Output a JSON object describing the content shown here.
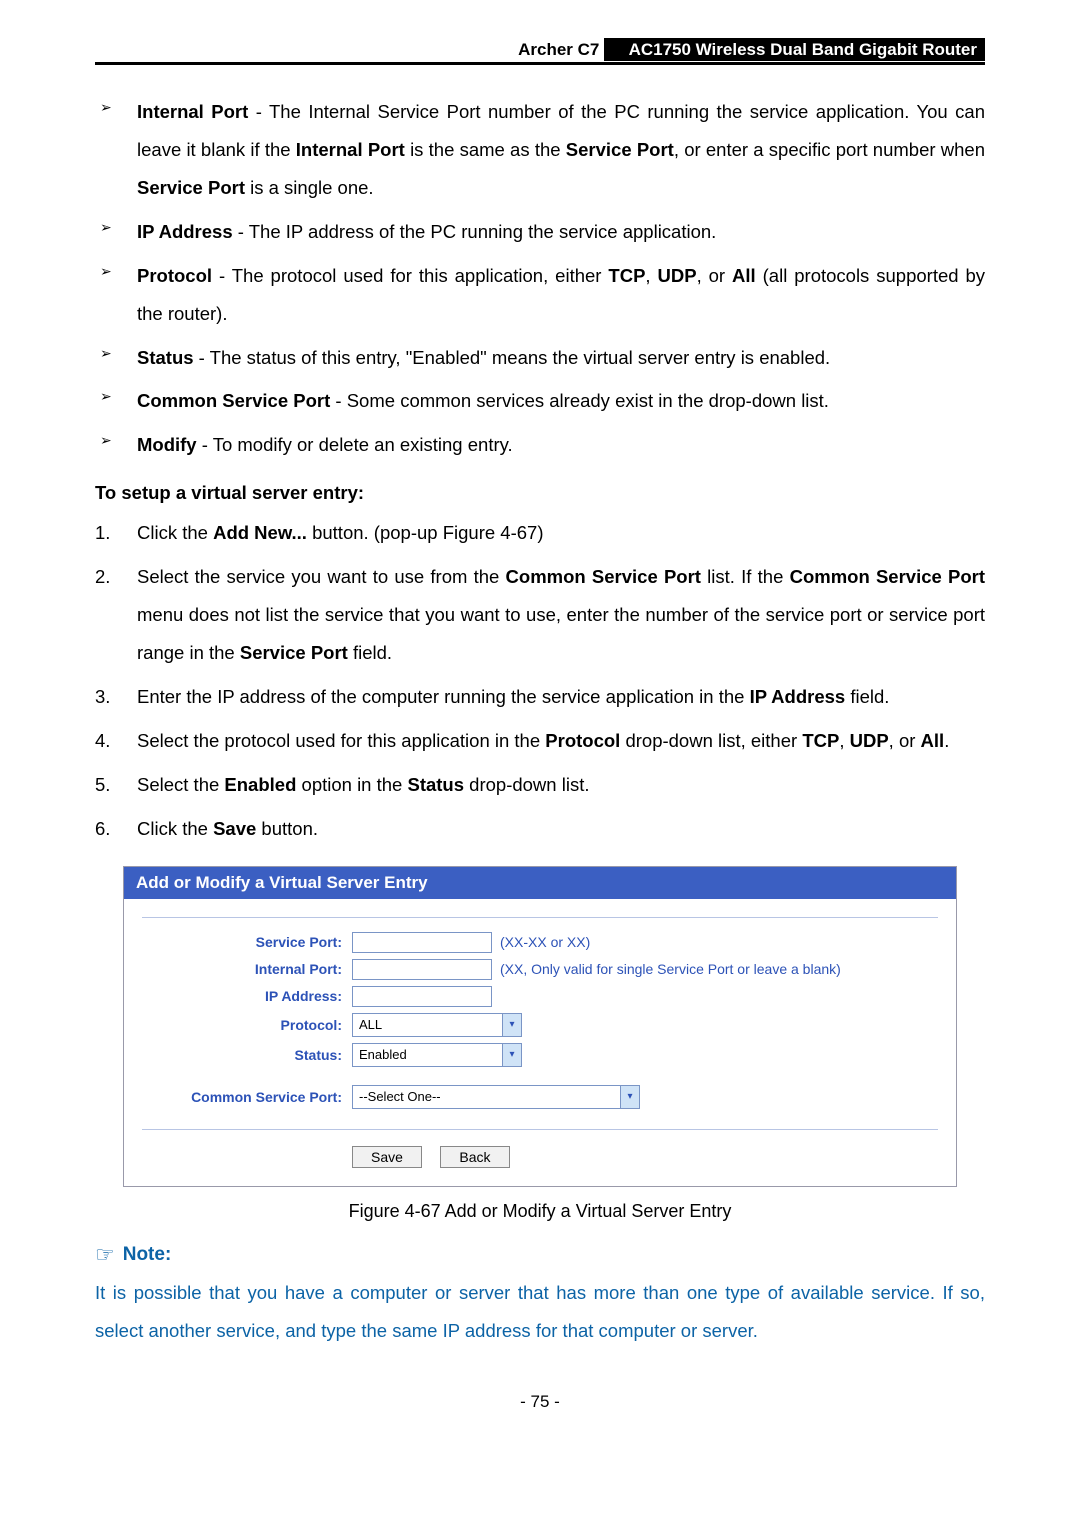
{
  "header": {
    "product": "Archer C7",
    "desc": "AC1750 Wireless Dual Band Gigabit Router"
  },
  "bullets": {
    "internal_port": "Internal Port - The Internal Service Port number of the PC running the service application. You can leave it blank if the Internal Port is the same as the Service Port, or enter a specific port number when Service Port is a single one.",
    "ip_address": "IP Address - The IP address of the PC running the service application.",
    "protocol": "Protocol - The protocol used for this application, either TCP, UDP, or All (all protocols supported by the router).",
    "status": "Status - The status of this entry, \"Enabled\" means the virtual server entry is enabled.",
    "common_service_port": "Common Service Port - Some common services already exist in the drop-down list.",
    "modify": "Modify - To modify or delete an existing entry."
  },
  "section_title": "To setup a virtual server entry:",
  "steps": {
    "s1": "Click the Add New... button. (pop-up Figure 4-67)",
    "s2": "Select the service you want to use from the Common Service Port list. If the Common Service Port menu does not list the service that you want to use, enter the number of the service port or service port range in the Service Port field.",
    "s3": "Enter the IP address of the computer running the service application in the IP Address field.",
    "s4": "Select the protocol used for this application in the Protocol drop-down list, either TCP, UDP, or All.",
    "s5": "Select the Enabled option in the Status drop-down list.",
    "s6": "Click the Save button."
  },
  "figure": {
    "title": "Add or Modify a Virtual Server Entry",
    "labels": {
      "service_port": "Service Port:",
      "internal_port": "Internal Port:",
      "ip_address": "IP Address:",
      "protocol": "Protocol:",
      "status": "Status:",
      "common": "Common Service Port:"
    },
    "hints": {
      "service_port": "(XX-XX or XX)",
      "internal_port": "(XX, Only valid for single Service Port or leave a blank)"
    },
    "values": {
      "protocol": "ALL",
      "status": "Enabled",
      "common": "--Select One--"
    },
    "buttons": {
      "save": "Save",
      "back": "Back"
    }
  },
  "caption": "Figure 4-67 Add or Modify a Virtual Server Entry",
  "note_label": "Note:",
  "note_text": "It is possible that you have a computer or server that has more than one type of available service. If so, select another service, and type the same IP address for that computer or server.",
  "pagenum": "- 75 -"
}
